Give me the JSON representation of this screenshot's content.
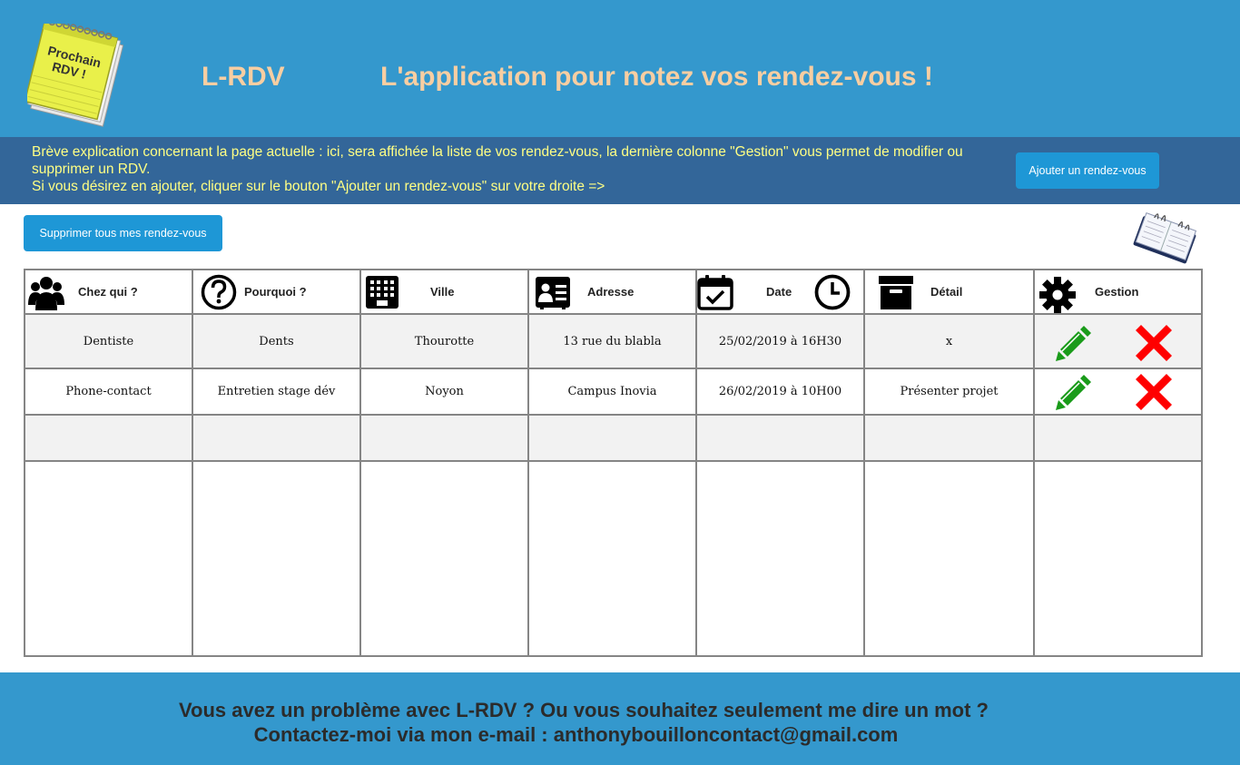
{
  "header": {
    "logo_text_line1": "Prochain",
    "logo_text_line2": "RDV !",
    "app_name": "L-RDV",
    "tagline": "L'application pour notez vos rendez-vous !",
    "background_color": "#3498cd",
    "title_color": "#f8cea2"
  },
  "info": {
    "line1": "Brève explication concernant la page actuelle : ici, sera affichée la liste de vos rendez-vous, la dernière colonne \"Gestion\" vous permet de modifier ou",
    "line2": "supprimer un RDV.",
    "line3": "Si vous désirez en ajouter, cliquer sur le bouton \"Ajouter un rendez-vous\" sur votre droite =>",
    "add_button_label": "Ajouter un rendez-vous",
    "background_color": "#336699",
    "text_color": "#ffff84"
  },
  "actions": {
    "delete_all_label": "Supprimer tous mes rendez-vous",
    "agenda_icon": "agenda-notebook-icon"
  },
  "table": {
    "columns": [
      {
        "label": "Chez qui ?",
        "icon": "users-group-icon"
      },
      {
        "label": "Pourquoi ?",
        "icon": "question-circle-icon"
      },
      {
        "label": "Ville",
        "icon": "building-icon"
      },
      {
        "label": "Adresse",
        "icon": "contact-card-icon"
      },
      {
        "label": "Date",
        "icon": "calendar-check-icon",
        "icon2": "clock-icon"
      },
      {
        "label": "Détail",
        "icon": "archive-box-icon"
      },
      {
        "label": "Gestion",
        "icon": "gear-icon"
      }
    ],
    "rows": [
      {
        "who": "Dentiste",
        "why": "Dents",
        "city": "Thourotte",
        "address": "13 rue du blabla",
        "date": "25/02/2019 à 16H30",
        "detail": "x"
      },
      {
        "who": "Phone-contact",
        "why": "Entretien stage dév",
        "city": "Noyon",
        "address": "Campus Inovia",
        "date": "26/02/2019 à 10H00",
        "detail": "Présenter projet"
      }
    ],
    "edit_icon": "pencil-edit-icon",
    "delete_icon": "red-cross-delete-icon",
    "edit_color": "#1a9b1a",
    "delete_color": "#ff0000"
  },
  "footer": {
    "line1": "Vous avez un problème avec L-RDV ? Ou vous souhaitez seulement me dire un mot ?",
    "line2": "Contactez-moi via mon e-mail : anthonybouilloncontact@gmail.com"
  }
}
